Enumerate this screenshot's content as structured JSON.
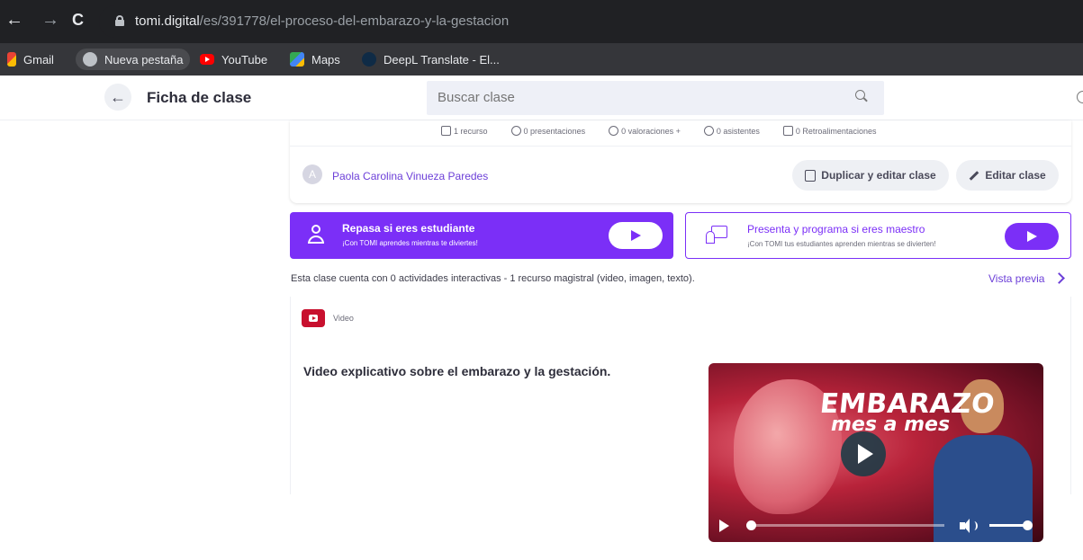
{
  "browser": {
    "url_host": "tomi.digital",
    "url_path": "/es/391778/el-proceso-del-embarazo-y-la-gestacion",
    "bookmarks": [
      {
        "label": "Gmail",
        "icon": "gmail-icon"
      },
      {
        "label": "Nueva pestaña",
        "icon": "globe-icon"
      },
      {
        "label": "YouTube",
        "icon": "youtube-icon"
      },
      {
        "label": "Maps",
        "icon": "maps-icon"
      },
      {
        "label": "DeepL Translate - El...",
        "icon": "deepl-icon"
      }
    ]
  },
  "header": {
    "title": "Ficha de clase",
    "search_placeholder": "Buscar clase"
  },
  "class_card": {
    "stats": [
      {
        "label": "1 recurso",
        "icon": "list-icon"
      },
      {
        "label": "0 presentaciones",
        "icon": "play-circle-icon"
      },
      {
        "label": "0 valoraciones +",
        "icon": "smiley-icon"
      },
      {
        "label": "0 asistentes",
        "icon": "group-icon"
      },
      {
        "label": "0 Retroalimentaciones",
        "icon": "chat-icon"
      }
    ],
    "author": "Paola Carolina Vinueza Paredes",
    "duplicate_label": "Duplicar y editar clase",
    "edit_label": "Editar clase"
  },
  "banners": {
    "student": {
      "title": "Repasa si eres estudiante",
      "subtitle": "¡Con TOMI aprendes mientras te diviertes!"
    },
    "teacher": {
      "title": "Presenta y programa si eres maestro",
      "subtitle": "¡Con TOMI tus estudiantes aprenden mientras se divierten!"
    }
  },
  "summary": {
    "text": "Esta clase cuenta con 0 actividades interactivas - 1 recurso magistral (video, imagen, texto).",
    "preview_label": "Vista previa"
  },
  "resource": {
    "type_label": "Video",
    "description": "Video explicativo sobre el embarazo y la gestación.",
    "thumbnail_title_1": "EMBARAZO",
    "thumbnail_title_2": "mes a mes",
    "progress": 0,
    "volume": 1.0
  },
  "colors": {
    "accent": "#7b2ff7",
    "link": "#6c3fd8",
    "youtube_red": "#c8102e"
  }
}
